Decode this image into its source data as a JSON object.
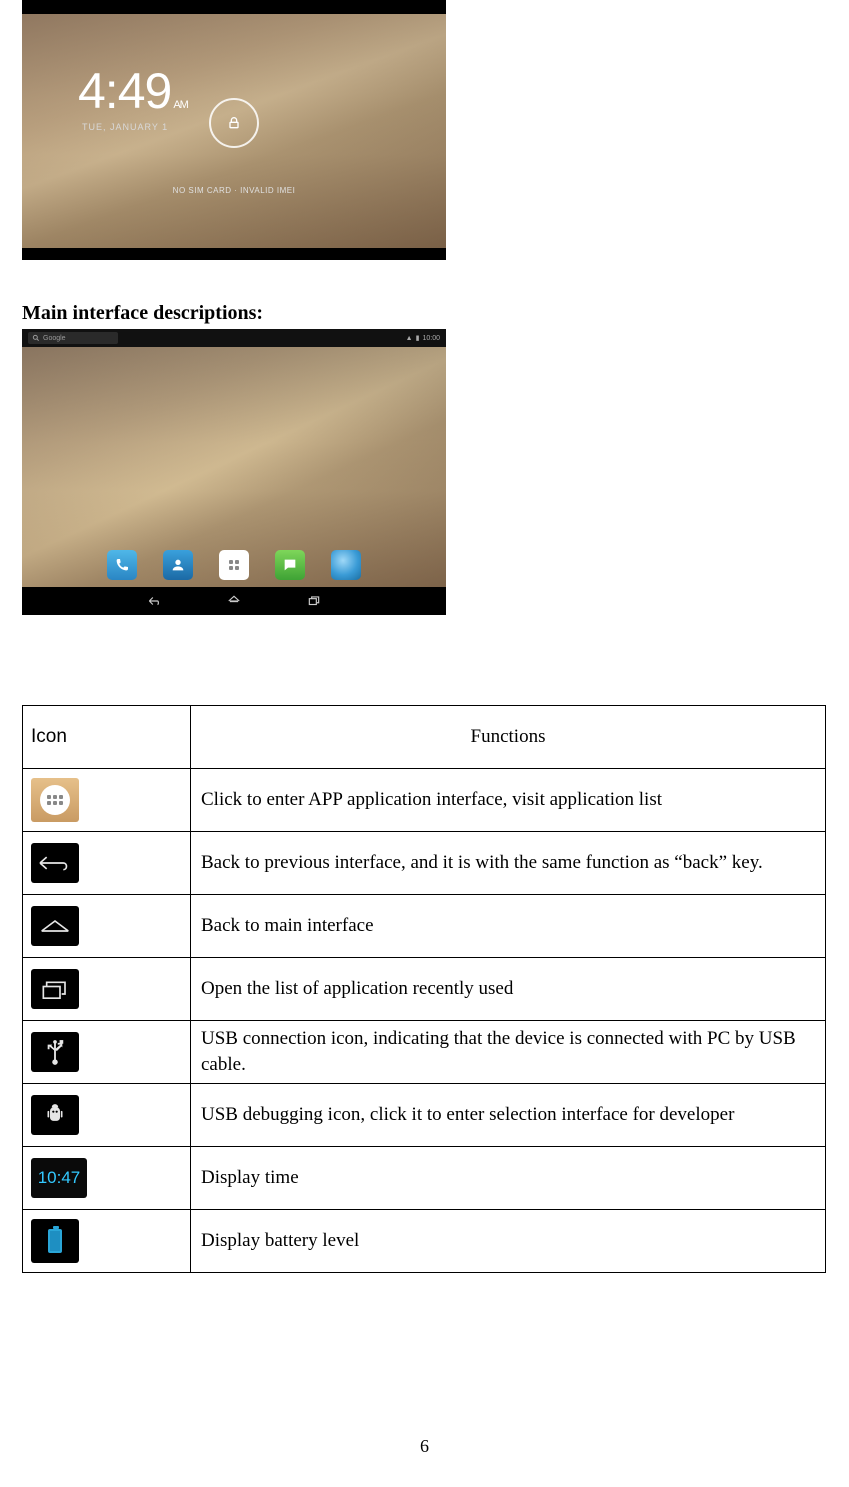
{
  "lockscreen": {
    "time": "4:49",
    "ampm": "AM",
    "date": "TUE, JANUARY 1",
    "sim_text": "NO SIM CARD · INVALID IMEI"
  },
  "heading": "Main interface descriptions:",
  "homescreen": {
    "search_placeholder": "Google",
    "status_time": "10:00"
  },
  "table": {
    "header_icon": "Icon",
    "header_func": "Functions",
    "rows": [
      {
        "icon": "apps-icon",
        "func": "Click to enter APP application interface, visit application list"
      },
      {
        "icon": "back-icon",
        "func": "Back to previous interface, and it is with the same function as “back” key."
      },
      {
        "icon": "home-icon",
        "func": "Back to main interface"
      },
      {
        "icon": "recents-icon",
        "func": "Open the list of application recently used"
      },
      {
        "icon": "usb-icon",
        "func": "USB connection icon, indicating that the device is connected with PC by USB cable."
      },
      {
        "icon": "usb-debug-icon",
        "func": "USB debugging icon, click it to enter selection interface for developer"
      },
      {
        "icon": "time-icon",
        "time_value": "10:47",
        "func": "Display time"
      },
      {
        "icon": "battery-icon",
        "func": "Display battery level"
      }
    ]
  },
  "page_number": "6"
}
